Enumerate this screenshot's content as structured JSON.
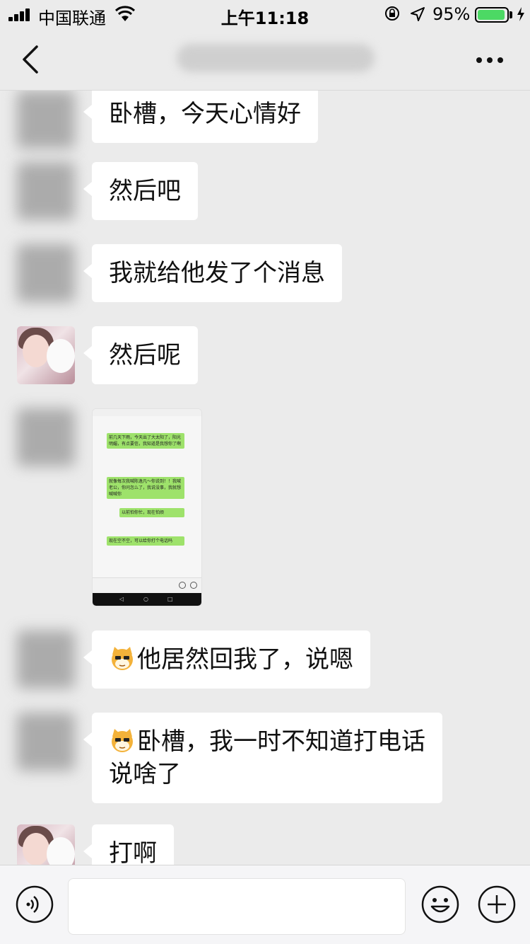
{
  "status_bar": {
    "carrier": "中国联通",
    "time": "上午11:18",
    "battery_percent_label": "95%",
    "battery_level": 0.95,
    "icons": [
      "signal-icon",
      "wifi-icon",
      "orientation-lock-icon",
      "location-arrow-icon",
      "battery-icon",
      "charging-icon"
    ]
  },
  "nav": {
    "back_icon": "chevron-left-icon",
    "title": "",
    "more_icon": "more-dots-icon"
  },
  "messages": [
    {
      "avatar": "blurred",
      "text": "卧槽，今天心情好"
    },
    {
      "avatar": "blurred",
      "text": "然后吧"
    },
    {
      "avatar": "blurred",
      "text": "我就给他发了个消息"
    },
    {
      "avatar": "photo",
      "text": "然后呢"
    },
    {
      "avatar": "blurred",
      "type": "image",
      "screenshot": {
        "bubbles": [
          "前几天下雨，今天出了大太阳了，阳光明媚，有点要信，我知道是我想你了啊",
          "就像每次我喊陈逸凡～你说到！！我喊老公，你问怎么了，我说没事，我就想喊喊你",
          "以前怕你忙，现在怕烦",
          "现在空不空，可以给你打个电话吗"
        ]
      }
    },
    {
      "avatar": "blurred",
      "emoji": "cat-emoji-icon",
      "text": "他居然回我了，说嗯"
    },
    {
      "avatar": "blurred",
      "emoji": "cat-emoji-icon",
      "text_line1": "卧槽，我一时不知道打电话",
      "text_line2": "说啥了"
    },
    {
      "avatar": "photo",
      "text": "打啊"
    }
  ],
  "input_bar": {
    "voice_icon": "voice-icon",
    "input_value": "",
    "emoji_icon": "emoji-face-icon",
    "plus_icon": "plus-circle-icon"
  },
  "colors": {
    "background": "#ebebeb",
    "bubble": "#ffffff",
    "battery": "#4cd964",
    "wechat_green": "#9ee26b"
  }
}
